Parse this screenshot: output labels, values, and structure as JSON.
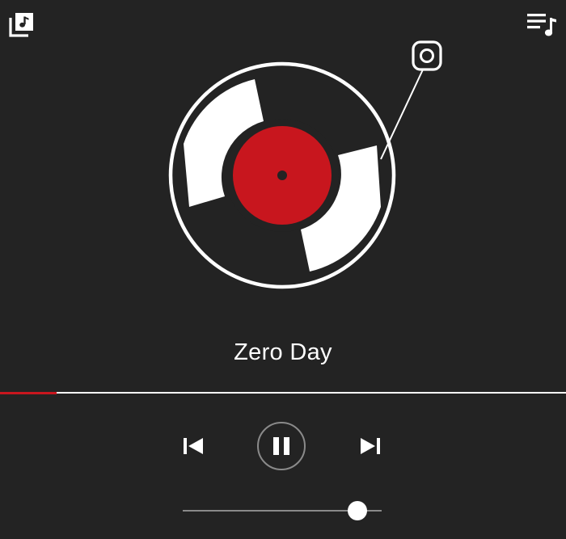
{
  "icons": {
    "library": "music-library-icon",
    "queue": "playlist-queue-icon",
    "record": "vinyl-record-icon",
    "tonearm": "tonearm-icon",
    "previous": "skip-previous-icon",
    "pause": "pause-icon",
    "next": "skip-next-icon"
  },
  "colors": {
    "background": "#232323",
    "accent": "#c8161e",
    "foreground": "#ffffff"
  },
  "now_playing": {
    "title": "Zero Day",
    "state": "playing",
    "progress_fraction": 0.1
  },
  "volume": {
    "level_fraction": 0.88
  }
}
